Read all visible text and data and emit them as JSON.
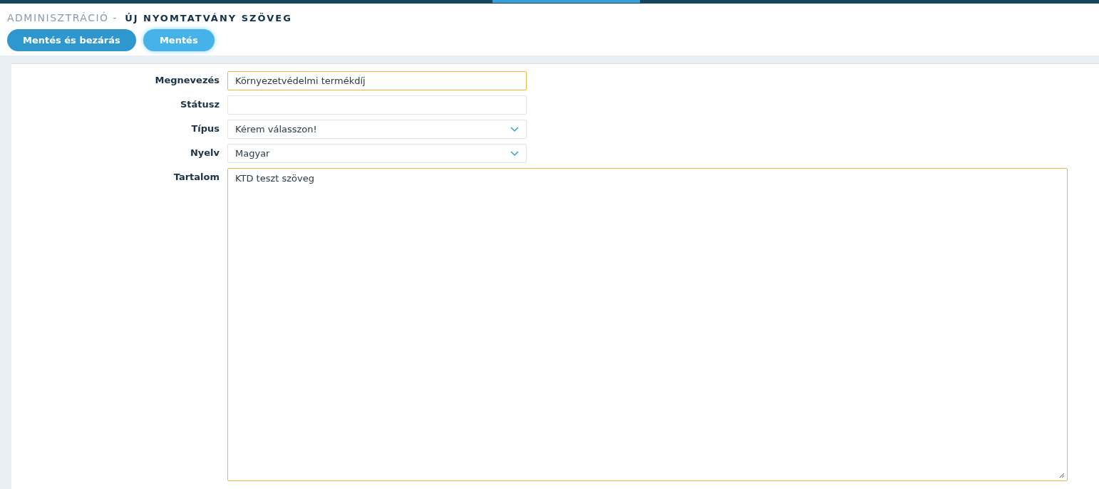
{
  "header": {
    "section": "ADMINISZTRÁCIÓ -",
    "title": "ÚJ NYOMTATVÁNY SZÖVEG"
  },
  "buttons": [
    {
      "label": "Mentés és bezárás",
      "kind": "primary"
    },
    {
      "label": "Mentés",
      "kind": "secondary"
    }
  ],
  "fields": [
    {
      "label": "Megnevezés",
      "kind": "text",
      "value": "Környezetvédelmi termékdíj",
      "focused": true
    },
    {
      "label": "Státusz",
      "kind": "text",
      "focused": false
    },
    {
      "label": "Típus",
      "kind": "select",
      "value": "Kérem válasszon!",
      "focused": false
    },
    {
      "label": "Nyelv",
      "kind": "select",
      "value": "Magyar",
      "focused": false
    },
    {
      "label": "Tartalom",
      "kind": "textarea",
      "value": "KTD teszt szöveg",
      "focused": true
    }
  ]
}
